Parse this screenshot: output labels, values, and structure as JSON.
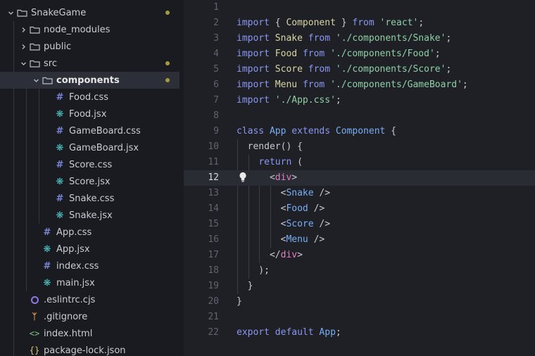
{
  "colors": {
    "folder_icon": "#b9bdc6",
    "hash_icon": "#7a86d8",
    "react_icon": "#4fc7c7",
    "eslint_icon": "#8f77e8",
    "git_icon": "#e49a4a",
    "modified_dot": "#a69a3c",
    "keyword": "#8a97f0",
    "string": "#8fd0a6",
    "component": "#78aef2",
    "jsx_tag": "#e07ec0"
  },
  "sidebar": {
    "items": [
      {
        "label": "SnakeGame",
        "type": "folder",
        "expanded": true,
        "depth": 0,
        "modified": true
      },
      {
        "label": "node_modules",
        "type": "folder",
        "expanded": false,
        "depth": 1
      },
      {
        "label": "public",
        "type": "folder",
        "expanded": false,
        "depth": 1
      },
      {
        "label": "src",
        "type": "folder",
        "expanded": true,
        "depth": 1,
        "modified": true
      },
      {
        "label": "components",
        "type": "folder",
        "expanded": true,
        "depth": 2,
        "selected": true,
        "bold": true,
        "modified": true
      },
      {
        "label": "Food.css",
        "type": "css",
        "depth": 3
      },
      {
        "label": "Food.jsx",
        "type": "react",
        "depth": 3
      },
      {
        "label": "GameBoard.css",
        "type": "css",
        "depth": 3
      },
      {
        "label": "GameBoard.jsx",
        "type": "react",
        "depth": 3
      },
      {
        "label": "Score.css",
        "type": "css",
        "depth": 3
      },
      {
        "label": "Score.jsx",
        "type": "react",
        "depth": 3
      },
      {
        "label": "Snake.css",
        "type": "css",
        "depth": 3
      },
      {
        "label": "Snake.jsx",
        "type": "react",
        "depth": 3
      },
      {
        "label": "App.css",
        "type": "css",
        "depth": 2
      },
      {
        "label": "App.jsx",
        "type": "react",
        "depth": 2
      },
      {
        "label": "index.css",
        "type": "css",
        "depth": 2
      },
      {
        "label": "main.jsx",
        "type": "react",
        "depth": 2
      },
      {
        "label": ".eslintrc.cjs",
        "type": "eslint",
        "depth": 1
      },
      {
        "label": ".gitignore",
        "type": "git",
        "depth": 1
      },
      {
        "label": "index.html",
        "type": "html",
        "depth": 1
      },
      {
        "label": "package-lock.json",
        "type": "json",
        "depth": 1
      }
    ]
  },
  "editor": {
    "current_line": 12,
    "lines": [
      {
        "n": "1",
        "tokens": []
      },
      {
        "n": "2",
        "tokens": [
          [
            "kw",
            "import"
          ],
          [
            "p",
            " { "
          ],
          [
            "cls",
            "Component"
          ],
          [
            "p",
            " } "
          ],
          [
            "kw",
            "from"
          ],
          [
            "p",
            " "
          ],
          [
            "str",
            "'react'"
          ],
          [
            "p",
            ";"
          ]
        ]
      },
      {
        "n": "3",
        "tokens": [
          [
            "kw",
            "import"
          ],
          [
            "p",
            " "
          ],
          [
            "cls",
            "Snake"
          ],
          [
            "p",
            " "
          ],
          [
            "kw",
            "from"
          ],
          [
            "p",
            " "
          ],
          [
            "str",
            "'./components/Snake'"
          ],
          [
            "p",
            ";"
          ]
        ]
      },
      {
        "n": "4",
        "tokens": [
          [
            "kw",
            "import"
          ],
          [
            "p",
            " "
          ],
          [
            "cls",
            "Food"
          ],
          [
            "p",
            " "
          ],
          [
            "kw",
            "from"
          ],
          [
            "p",
            " "
          ],
          [
            "str",
            "'./components/Food'"
          ],
          [
            "p",
            ";"
          ]
        ]
      },
      {
        "n": "5",
        "tokens": [
          [
            "kw",
            "import"
          ],
          [
            "p",
            " "
          ],
          [
            "cls",
            "Score"
          ],
          [
            "p",
            " "
          ],
          [
            "kw",
            "from"
          ],
          [
            "p",
            " "
          ],
          [
            "str",
            "'./components/Score'"
          ],
          [
            "p",
            ";"
          ]
        ]
      },
      {
        "n": "6",
        "tokens": [
          [
            "kw",
            "import"
          ],
          [
            "p",
            " "
          ],
          [
            "cls",
            "Menu"
          ],
          [
            "p",
            " "
          ],
          [
            "kw",
            "from"
          ],
          [
            "p",
            " "
          ],
          [
            "str",
            "'./components/GameBoard'"
          ],
          [
            "p",
            ";"
          ]
        ]
      },
      {
        "n": "7",
        "tokens": [
          [
            "kw",
            "import"
          ],
          [
            "p",
            " "
          ],
          [
            "str",
            "'./App.css'"
          ],
          [
            "p",
            ";"
          ]
        ]
      },
      {
        "n": "8",
        "tokens": []
      },
      {
        "n": "9",
        "tokens": [
          [
            "kw",
            "class"
          ],
          [
            "p",
            " "
          ],
          [
            "ty",
            "App"
          ],
          [
            "p",
            " "
          ],
          [
            "kw",
            "extends"
          ],
          [
            "p",
            " "
          ],
          [
            "ty",
            "Component"
          ],
          [
            "p",
            " {"
          ]
        ]
      },
      {
        "n": "10",
        "tokens": [
          [
            "p",
            "  "
          ],
          [
            "fn",
            "render"
          ],
          [
            "p",
            "() {"
          ]
        ]
      },
      {
        "n": "11",
        "tokens": [
          [
            "p",
            "    "
          ],
          [
            "kw",
            "return"
          ],
          [
            "p",
            " ("
          ]
        ]
      },
      {
        "n": "12",
        "tokens": [
          [
            "p",
            "      <"
          ],
          [
            "tag",
            "div"
          ],
          [
            "p",
            ">"
          ]
        ]
      },
      {
        "n": "13",
        "tokens": [
          [
            "p",
            "        <"
          ],
          [
            "ty",
            "Snake"
          ],
          [
            "p",
            " />"
          ]
        ]
      },
      {
        "n": "14",
        "tokens": [
          [
            "p",
            "        <"
          ],
          [
            "ty",
            "Food"
          ],
          [
            "p",
            " />"
          ]
        ]
      },
      {
        "n": "15",
        "tokens": [
          [
            "p",
            "        <"
          ],
          [
            "ty",
            "Score"
          ],
          [
            "p",
            " />"
          ]
        ]
      },
      {
        "n": "16",
        "tokens": [
          [
            "p",
            "        <"
          ],
          [
            "ty",
            "Menu"
          ],
          [
            "p",
            " />"
          ]
        ]
      },
      {
        "n": "17",
        "tokens": [
          [
            "p",
            "      </"
          ],
          [
            "tag",
            "div"
          ],
          [
            "p",
            ">"
          ]
        ]
      },
      {
        "n": "18",
        "tokens": [
          [
            "p",
            "    );"
          ]
        ]
      },
      {
        "n": "19",
        "tokens": [
          [
            "p",
            "  }"
          ]
        ]
      },
      {
        "n": "20",
        "tokens": [
          [
            "p",
            "}"
          ]
        ]
      },
      {
        "n": "21",
        "tokens": []
      },
      {
        "n": "22",
        "tokens": [
          [
            "kw",
            "export"
          ],
          [
            "p",
            " "
          ],
          [
            "kw",
            "default"
          ],
          [
            "p",
            " "
          ],
          [
            "ty",
            "App"
          ],
          [
            "p",
            ";"
          ]
        ]
      }
    ]
  }
}
